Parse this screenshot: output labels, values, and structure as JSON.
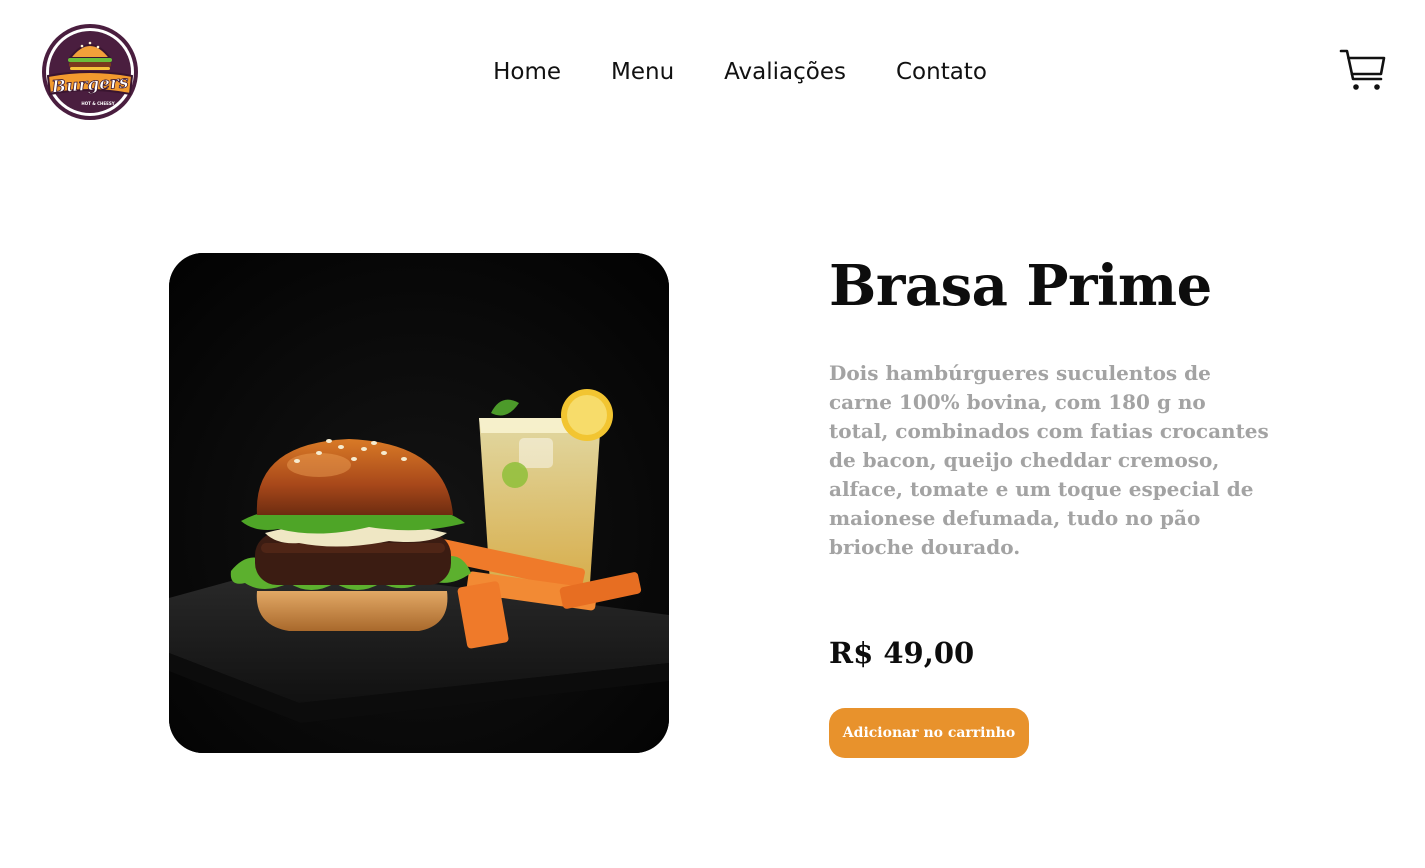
{
  "brand": {
    "name": "Burgers",
    "tagline": "HOT & CHEESY",
    "colors": {
      "accent": "#e8922c",
      "logo_ring": "#4a1e3f",
      "logo_text": "#f29a2e"
    }
  },
  "nav": {
    "items": [
      {
        "label": "Home"
      },
      {
        "label": "Menu"
      },
      {
        "label": "Avaliações"
      },
      {
        "label": "Contato"
      }
    ]
  },
  "header": {
    "cart_icon": "cart-icon"
  },
  "product": {
    "image_icon": "burger-photo",
    "title": "Brasa Prime",
    "description": "Dois hambúrgueres suculentos de carne 100% bovina, com 180 g no total, combinados com fatias crocantes de bacon, queijo cheddar cremoso, alface, tomate e um toque especial de maionese defumada, tudo no pão brioche dourado.",
    "price": "R$ 49,00",
    "add_button_label": "Adicionar no carrinho"
  }
}
